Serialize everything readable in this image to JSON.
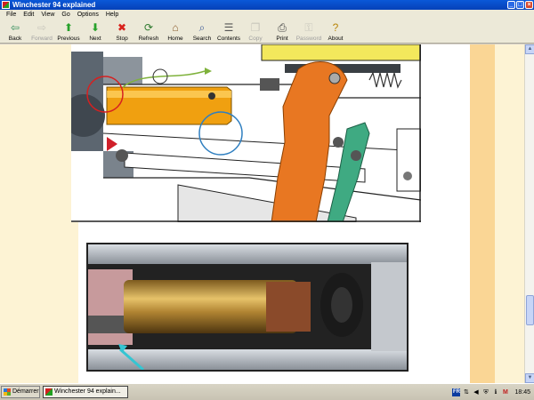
{
  "window": {
    "title": "Winchester 94 explained"
  },
  "menu": [
    "File",
    "Edit",
    "View",
    "Go",
    "Options",
    "Help"
  ],
  "toolbar": [
    {
      "label": "Back",
      "icon": "back-arrow-icon",
      "enabled": true,
      "glyph": "⇦",
      "color": "#2e8b57"
    },
    {
      "label": "Forward",
      "icon": "forward-arrow-icon",
      "enabled": false,
      "glyph": "⇨",
      "color": "#888888"
    },
    {
      "label": "Previous",
      "icon": "up-arrow-icon",
      "enabled": true,
      "glyph": "⬆",
      "color": "#27a12a"
    },
    {
      "label": "Next",
      "icon": "down-arrow-icon",
      "enabled": true,
      "glyph": "⬇",
      "color": "#27a12a"
    },
    {
      "label": "Stop",
      "icon": "stop-icon",
      "enabled": true,
      "glyph": "✖",
      "color": "#d8221b"
    },
    {
      "label": "Refresh",
      "icon": "refresh-icon",
      "enabled": true,
      "glyph": "⟳",
      "color": "#2f7a2f"
    },
    {
      "label": "Home",
      "icon": "home-icon",
      "enabled": true,
      "glyph": "⌂",
      "color": "#8a5a2b"
    },
    {
      "label": "Search",
      "icon": "search-icon",
      "enabled": true,
      "glyph": "⌕",
      "color": "#3b5998"
    },
    {
      "label": "Contents",
      "icon": "contents-icon",
      "enabled": true,
      "glyph": "☰",
      "color": "#555555"
    },
    {
      "label": "Copy",
      "icon": "copy-icon",
      "enabled": false,
      "glyph": "❐",
      "color": "#888888"
    },
    {
      "label": "Print",
      "icon": "print-icon",
      "enabled": true,
      "glyph": "⎙",
      "color": "#444444"
    },
    {
      "label": "Password",
      "icon": "password-icon",
      "enabled": false,
      "glyph": "⚿",
      "color": "#888888"
    },
    {
      "label": "About",
      "icon": "about-icon",
      "enabled": true,
      "glyph": "?",
      "color": "#b8860b"
    }
  ],
  "taskbar": {
    "start_label": "Démarrer",
    "task_label": "Winchester 94 explain...",
    "tray_lang": "FR",
    "clock": "18:45"
  },
  "colors": {
    "page_left": "#fdf3d4",
    "page_content": "#ffffff",
    "page_stripe": "#fad695",
    "cartridge": "#f0a010",
    "lever": "#e87722",
    "spring_part": "#3faa82"
  }
}
